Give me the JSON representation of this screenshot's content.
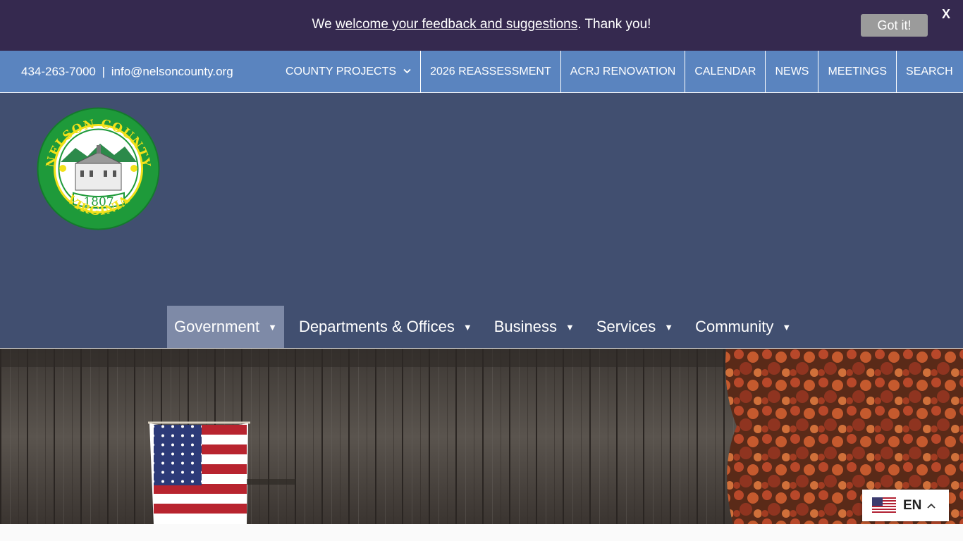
{
  "banner": {
    "text_before": "We ",
    "link_text": "welcome your feedback and suggestions",
    "text_after": ". Thank you!",
    "button_label": "Got it!",
    "close_label": "X"
  },
  "topbar": {
    "phone": "434-263-7000",
    "separator": "|",
    "email": "info@nelsoncounty.org",
    "links": [
      {
        "label": "COUNTY PROJECTS"
      },
      {
        "label": "2026 REASSESSMENT"
      },
      {
        "label": "ACRJ RENOVATION"
      },
      {
        "label": "CALENDAR"
      },
      {
        "label": "NEWS"
      },
      {
        "label": "MEETINGS"
      },
      {
        "label": "SEARCH"
      }
    ]
  },
  "logo": {
    "top_text": "NELSON COUNTY",
    "year": "1807",
    "bottom_text": "VIRGINIA"
  },
  "main_nav": {
    "items": [
      {
        "label": "Government"
      },
      {
        "label": "Departments & Offices"
      },
      {
        "label": "Business"
      },
      {
        "label": "Services"
      },
      {
        "label": "Community"
      }
    ]
  },
  "language": {
    "code": "EN",
    "flag_icon": "us-flag-icon"
  },
  "colors": {
    "banner_bg": "#35294f",
    "topbar_bg": "#5a84bf",
    "header_bg": "#414f70",
    "nav_active_bg": "#7e8aa7",
    "logo_green": "#1e9a3a",
    "logo_yellow": "#f2e11a"
  }
}
